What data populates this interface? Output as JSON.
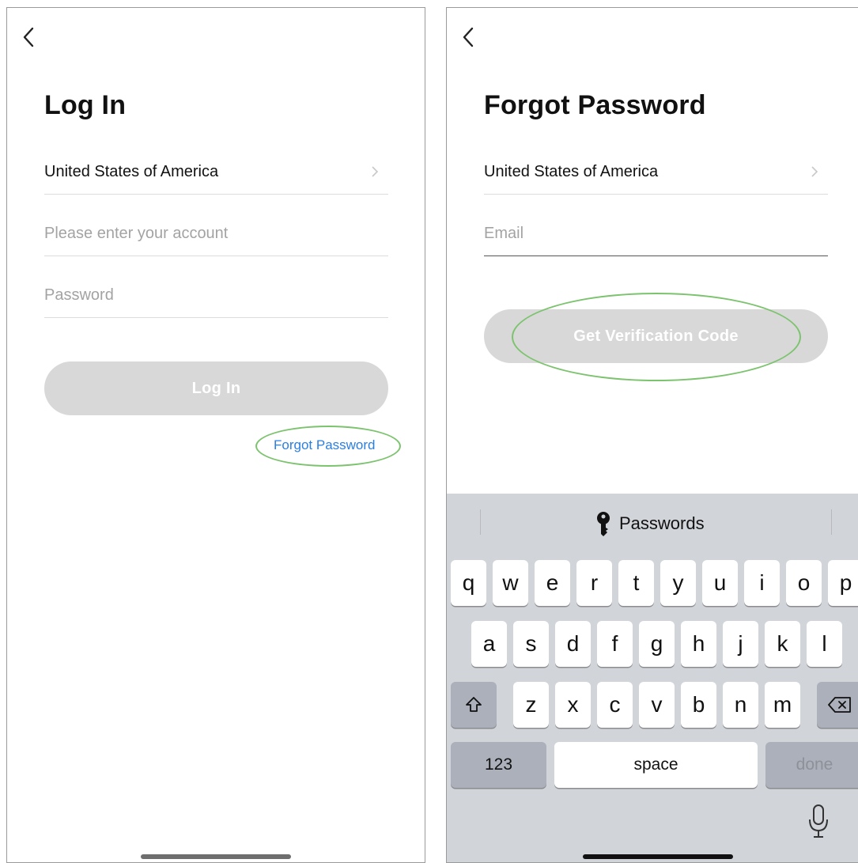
{
  "login": {
    "title": "Log In",
    "country": "United States of America",
    "account_placeholder": "Please enter your account",
    "password_placeholder": "Password",
    "login_button": "Log In",
    "forgot_link": "Forgot Password"
  },
  "forgot": {
    "title": "Forgot Password",
    "country": "United States of America",
    "email_placeholder": "Email",
    "get_code_button": "Get Verification Code"
  },
  "keyboard": {
    "suggestion": "Passwords",
    "row1": [
      "q",
      "w",
      "e",
      "r",
      "t",
      "y",
      "u",
      "i",
      "o",
      "p"
    ],
    "row2": [
      "a",
      "s",
      "d",
      "f",
      "g",
      "h",
      "j",
      "k",
      "l"
    ],
    "row3": [
      "z",
      "x",
      "c",
      "v",
      "b",
      "n",
      "m"
    ],
    "numbers_key": "123",
    "space_key": "space",
    "done_key": "done"
  },
  "icons": {
    "back": "chevron-left-icon",
    "country_chevron": "chevron-right-icon",
    "passwords": "key-icon",
    "shift": "shift-icon",
    "delete": "backspace-icon",
    "dictation": "microphone-icon"
  },
  "colors": {
    "link": "#2b7fe0",
    "annotation": "#7cc36e",
    "button_disabled": "#d8d8d8",
    "keyboard_bg": "#d1d4d9"
  }
}
